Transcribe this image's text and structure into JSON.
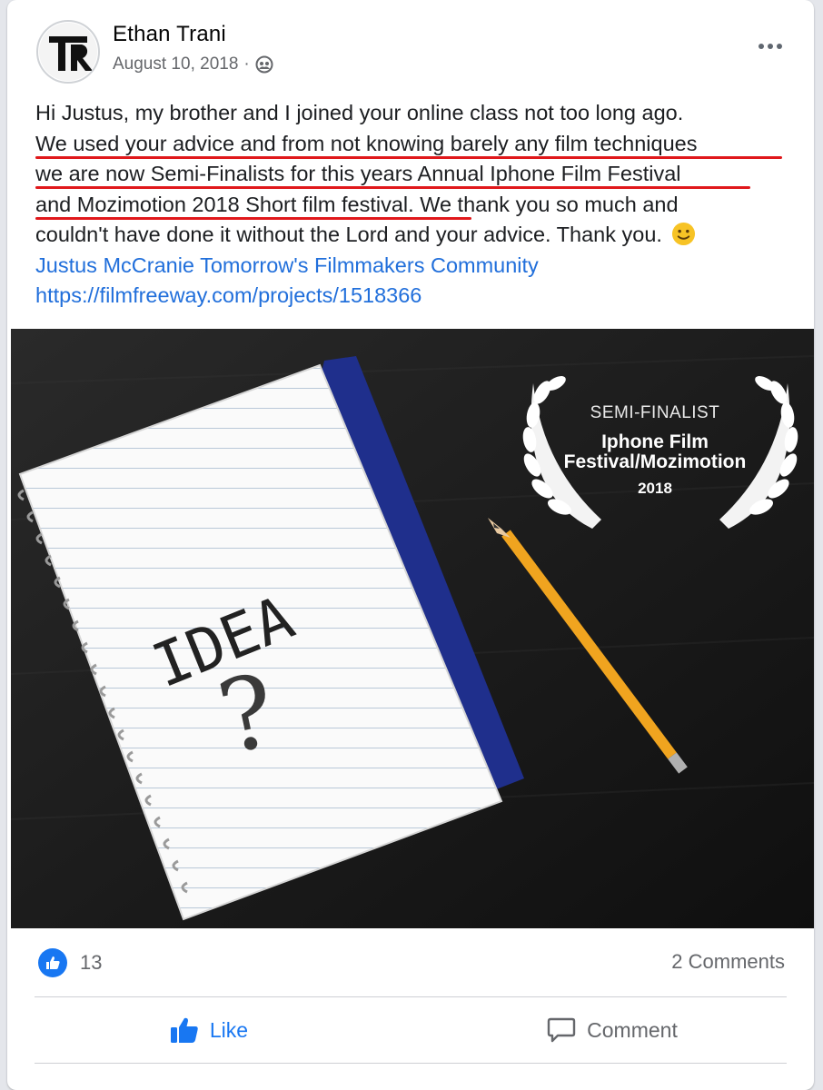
{
  "post": {
    "author": "Ethan Trani",
    "date": "August 10, 2018",
    "date_separator": "·",
    "privacy_icon": "friends-icon",
    "text_lines": [
      "Hi Justus, my brother and I joined your online class not too long ago.",
      "We used your advice and from not knowing barely any film techniques",
      "we are now Semi-Finalists for this years Annual Iphone Film Festival",
      "and Mozimotion 2018 Short film festival.",
      " We thank you so much and",
      "couldn't have done it without the Lord and your advice. Thank you."
    ],
    "tags": "Justus McCranie Tomorrow's Filmmakers Community",
    "url": "https://filmfreeway.com/projects/1518366",
    "emoji": "slightly-smiling-face-emoji"
  },
  "image": {
    "laurel_line1": "SEMI-FINALIST",
    "laurel_line2": "Iphone Film",
    "laurel_line3": "Festival/Mozimotion",
    "laurel_line4": "2018",
    "notebook_text": "IDEA",
    "notebook_mark": "?"
  },
  "footer": {
    "like_count": "13",
    "comments_count": "2 Comments",
    "like_label": "Like",
    "comment_label": "Comment"
  },
  "colors": {
    "accent": "#1877f2",
    "link": "#216fdb",
    "underline": "#e0181b"
  }
}
